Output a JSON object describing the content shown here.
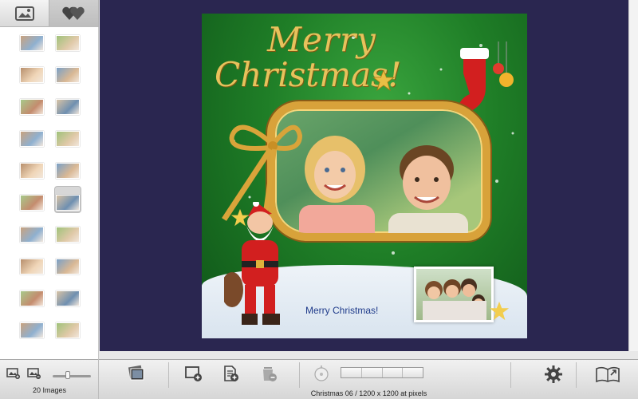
{
  "left_panel": {
    "tabs": [
      {
        "name": "photos-tab",
        "icon": "photo-icon"
      },
      {
        "name": "favorites-tab",
        "icon": "hearts-icon"
      }
    ],
    "thumbnail_count": 20,
    "selected_index": 9
  },
  "card": {
    "title_line1": "Merry",
    "title_line2": "Christmas!",
    "caption": "Merry Christmas!",
    "colors": {
      "background": "#1f7e27",
      "gold": "#e7c25c",
      "snow": "#e3ecf4"
    }
  },
  "canvas_background": "#2a2650",
  "toolbar": {
    "images_count": "20 Images",
    "slider_value": 0.4,
    "status": "Christmas 06 / 1200 x 1200 at pixels",
    "buttons": [
      {
        "name": "templates-button",
        "icon": "photos-stack-icon"
      },
      {
        "name": "add-frame-button",
        "icon": "add-frame-icon"
      },
      {
        "name": "add-page-button",
        "icon": "add-document-icon"
      },
      {
        "name": "delete-button",
        "icon": "trash-icon"
      },
      {
        "name": "rotate-button",
        "icon": "rotate-dial-icon"
      },
      {
        "name": "settings-button",
        "icon": "gear-icon"
      },
      {
        "name": "share-button",
        "icon": "open-book-share-icon"
      }
    ]
  }
}
